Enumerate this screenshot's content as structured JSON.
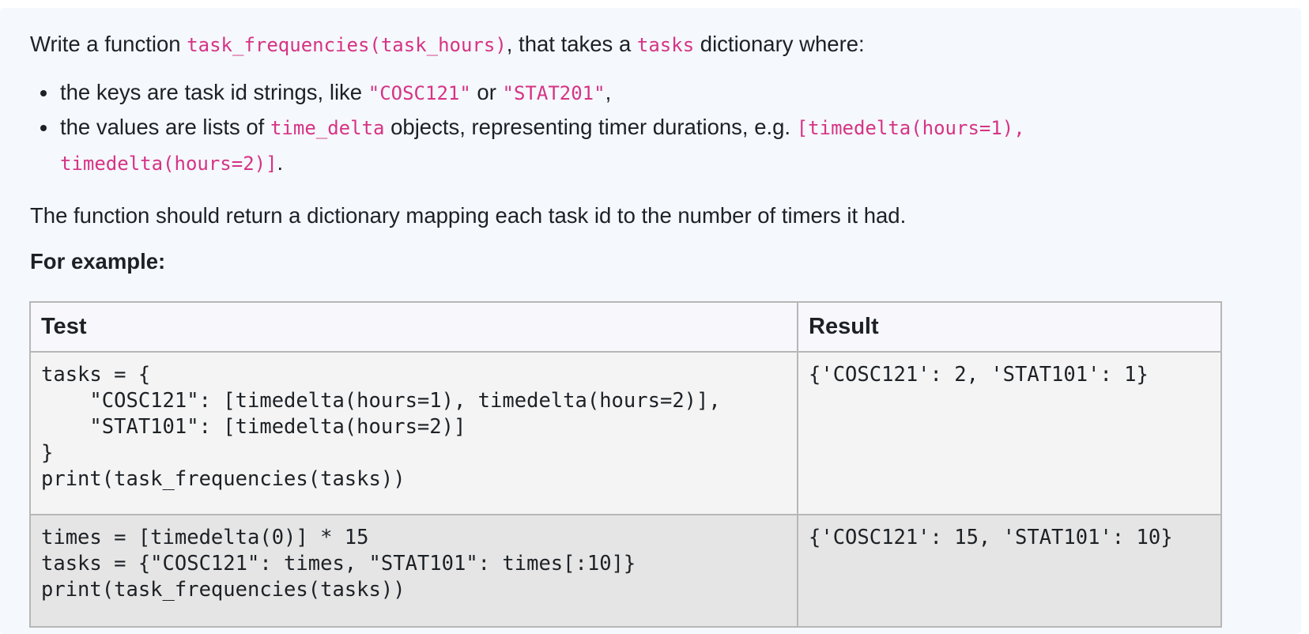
{
  "intro": {
    "part1": "Write a function ",
    "func_sig": "task_frequencies(task_hours)",
    "part2": ", that takes a ",
    "tasks_word": "tasks",
    "part3": " dictionary where:"
  },
  "bullets": [
    {
      "part1": "the keys are task id strings, like ",
      "code1": "\"COSC121\"",
      "part2": " or ",
      "code2": "\"STAT201\"",
      "part3": ","
    },
    {
      "part1": "the values are lists of ",
      "code1": "time_delta",
      "part2": " objects, representing timer durations, e.g. ",
      "code2": "[timedelta(hours=1),",
      "code3": "timedelta(hours=2)]",
      "part3": "."
    }
  ],
  "return_text": "The function should return a dictionary mapping each task id to the number of timers it had.",
  "example_heading": "For example:",
  "table": {
    "headers": [
      "Test",
      "Result"
    ],
    "rows": [
      {
        "test": "tasks = {\n    \"COSC121\": [timedelta(hours=1), timedelta(hours=2)],\n    \"STAT101\": [timedelta(hours=2)]\n}\nprint(task_frequencies(tasks))",
        "result": "{'COSC121': 2, 'STAT101': 1}"
      },
      {
        "test": "times = [timedelta(0)] * 15\ntasks = {\"COSC121\": times, \"STAT101\": times[:10]}\nprint(task_frequencies(tasks))",
        "result": "{'COSC121': 15, 'STAT101': 10}"
      }
    ]
  },
  "colors": {
    "code_text": "#d63384",
    "panel_bg": "#f5f8fd",
    "header_bg": "#f7f7fc",
    "row1_bg": "#f4f4f4",
    "row2_bg": "#e5e5e5",
    "border": "#b7b7b7"
  }
}
